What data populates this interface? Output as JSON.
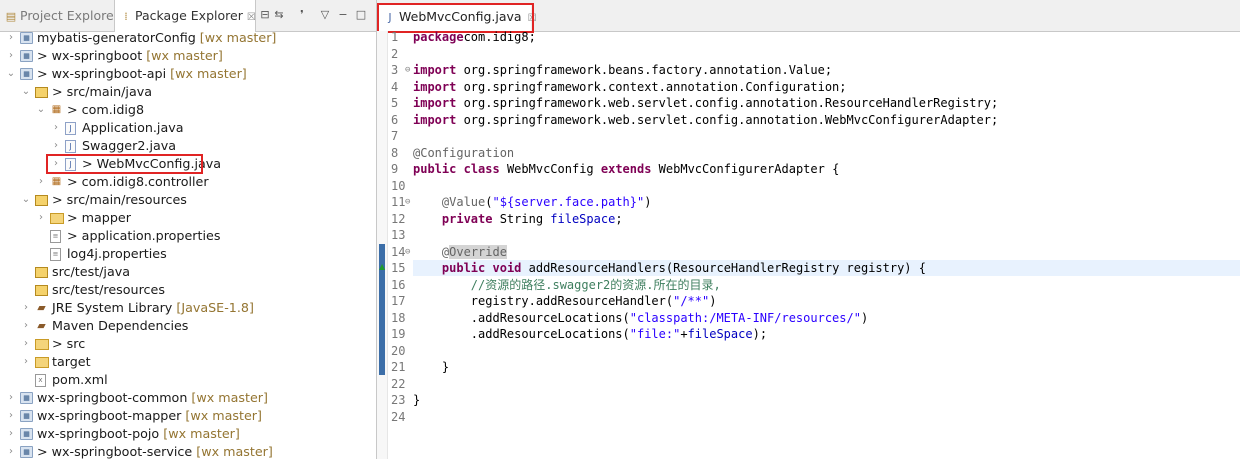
{
  "left_pane": {
    "tabs": [
      {
        "label": "Project Explorer"
      },
      {
        "label": "Package Explorer",
        "close": "☒"
      }
    ],
    "tree": [
      {
        "label": "mybatis-generatorConfig",
        "decoration": "[wx master]",
        "depth": 0,
        "expanded": false,
        "icon": "project-icon"
      },
      {
        "label": "> wx-springboot",
        "decoration": "[wx master]",
        "depth": 0,
        "expanded": false,
        "icon": "project-icon"
      },
      {
        "label": "> wx-springboot-api",
        "decoration": "[wx master]",
        "depth": 0,
        "expanded": true,
        "icon": "project-icon"
      },
      {
        "label": "> src/main/java",
        "decoration": "",
        "depth": 1,
        "expanded": true,
        "icon": "source-folder-icon"
      },
      {
        "label": "> com.idig8",
        "decoration": "",
        "depth": 2,
        "expanded": true,
        "icon": "package-icon"
      },
      {
        "label": "Application.java",
        "decoration": "",
        "depth": 3,
        "expanded": false,
        "icon": "java-file-icon"
      },
      {
        "label": "Swagger2.java",
        "decoration": "",
        "depth": 3,
        "expanded": false,
        "icon": "java-file-icon"
      },
      {
        "label": "> WebMvcConfig.java",
        "decoration": "",
        "depth": 3,
        "expanded": false,
        "icon": "java-file-icon",
        "selected": true
      },
      {
        "label": "> com.idig8.controller",
        "decoration": "",
        "depth": 2,
        "expanded": false,
        "icon": "package-icon"
      },
      {
        "label": "> src/main/resources",
        "decoration": "",
        "depth": 1,
        "expanded": true,
        "icon": "source-folder-icon"
      },
      {
        "label": "> mapper",
        "decoration": "",
        "depth": 2,
        "expanded": false,
        "icon": "folder-icon"
      },
      {
        "label": "> application.properties",
        "decoration": "",
        "depth": 2,
        "leaf": true,
        "icon": "properties-file-icon"
      },
      {
        "label": "log4j.properties",
        "decoration": "",
        "depth": 2,
        "leaf": true,
        "icon": "properties-file-icon"
      },
      {
        "label": "src/test/java",
        "decoration": "",
        "depth": 1,
        "leaf": true,
        "icon": "source-folder-icon"
      },
      {
        "label": "src/test/resources",
        "decoration": "",
        "depth": 1,
        "leaf": true,
        "icon": "source-folder-icon"
      },
      {
        "label": "JRE System Library",
        "decoration": "[JavaSE-1.8]",
        "depth": 1,
        "expanded": false,
        "icon": "library-icon"
      },
      {
        "label": "Maven Dependencies",
        "decoration": "",
        "depth": 1,
        "expanded": false,
        "icon": "library-icon"
      },
      {
        "label": "> src",
        "decoration": "",
        "depth": 1,
        "expanded": false,
        "icon": "folder-icon"
      },
      {
        "label": "target",
        "decoration": "",
        "depth": 1,
        "expanded": false,
        "icon": "folder-icon"
      },
      {
        "label": "pom.xml",
        "decoration": "",
        "depth": 1,
        "leaf": true,
        "icon": "xml-file-icon"
      },
      {
        "label": "wx-springboot-common",
        "decoration": "[wx master]",
        "depth": 0,
        "expanded": false,
        "icon": "project-icon"
      },
      {
        "label": "wx-springboot-mapper",
        "decoration": "[wx master]",
        "depth": 0,
        "expanded": false,
        "icon": "project-icon"
      },
      {
        "label": "wx-springboot-pojo",
        "decoration": "[wx master]",
        "depth": 0,
        "expanded": false,
        "icon": "project-icon"
      },
      {
        "label": "> wx-springboot-service",
        "decoration": "[wx master]",
        "depth": 0,
        "expanded": false,
        "icon": "project-icon"
      }
    ]
  },
  "editor": {
    "tab": {
      "label": "WebMvcConfig.java",
      "close": "☒"
    },
    "lines": [
      {
        "n": "1",
        "fold": "",
        "tokens": [
          [
            "kw",
            "package"
          ],
          [
            "",
            "com.idig8;"
          ]
        ]
      },
      {
        "n": "2",
        "fold": "",
        "tokens": []
      },
      {
        "n": "3",
        "fold": "⊖",
        "tokens": [
          [
            "kw",
            "import"
          ],
          [
            "",
            " org.springframework.beans.factory.annotation.Value;"
          ]
        ]
      },
      {
        "n": "4",
        "fold": "",
        "tokens": [
          [
            "kw",
            "import"
          ],
          [
            "",
            " org.springframework.context.annotation.Configuration;"
          ]
        ]
      },
      {
        "n": "5",
        "fold": "",
        "tokens": [
          [
            "kw",
            "import"
          ],
          [
            "",
            " org.springframework.web.servlet.config.annotation.ResourceHandlerRegistry;"
          ]
        ]
      },
      {
        "n": "6",
        "fold": "",
        "tokens": [
          [
            "kw",
            "import"
          ],
          [
            "",
            " org.springframework.web.servlet.config.annotation.WebMvcConfigurerAdapter;"
          ]
        ]
      },
      {
        "n": "7",
        "fold": "",
        "tokens": []
      },
      {
        "n": "8",
        "fold": "",
        "tokens": [
          [
            "ann",
            "@Configuration"
          ]
        ]
      },
      {
        "n": "9",
        "fold": "",
        "tokens": [
          [
            "kw",
            "public"
          ],
          [
            "",
            " "
          ],
          [
            "kw",
            "class"
          ],
          [
            "",
            " WebMvcConfig "
          ],
          [
            "kw",
            "extends"
          ],
          [
            "",
            " WebMvcConfigurerAdapter {"
          ]
        ]
      },
      {
        "n": "10",
        "fold": "",
        "tokens": []
      },
      {
        "n": "11",
        "fold": "⊖",
        "tokens": [
          [
            "",
            "    "
          ],
          [
            "ann",
            "@Value"
          ],
          [
            "",
            "("
          ],
          [
            "str",
            "\"${server.face.path}\""
          ],
          [
            "",
            ")"
          ]
        ]
      },
      {
        "n": "12",
        "fold": "",
        "tokens": [
          [
            "",
            "    "
          ],
          [
            "kw",
            "private"
          ],
          [
            "",
            " String "
          ],
          [
            "fld",
            "fileSpace"
          ],
          [
            "",
            ";"
          ]
        ]
      },
      {
        "n": "13",
        "fold": "",
        "tokens": []
      },
      {
        "n": "14",
        "fold": "⊖",
        "tokens": [
          [
            "",
            "    "
          ],
          [
            "ann",
            "@"
          ],
          [
            "ann ovr",
            "Override"
          ]
        ]
      },
      {
        "n": "15",
        "fold": "",
        "tokens": [
          [
            "",
            "    "
          ],
          [
            "kw",
            "public"
          ],
          [
            "",
            " "
          ],
          [
            "kw",
            "void"
          ],
          [
            "",
            " addResourceHandlers(ResourceHandlerRegistry registry) {"
          ]
        ]
      },
      {
        "n": "16",
        "fold": "",
        "tokens": [
          [
            "",
            "        "
          ],
          [
            "cmt",
            "//资源的路径.swagger2的资源.所在的目录,"
          ]
        ]
      },
      {
        "n": "17",
        "fold": "",
        "tokens": [
          [
            "",
            "        registry.addResourceHandler("
          ],
          [
            "str",
            "\"/**\""
          ],
          [
            "",
            ")"
          ]
        ]
      },
      {
        "n": "18",
        "fold": "",
        "tokens": [
          [
            "",
            "        .addResourceLocations("
          ],
          [
            "str",
            "\"classpath:/META-INF/resources/\""
          ],
          [
            "",
            ")"
          ]
        ]
      },
      {
        "n": "19",
        "fold": "",
        "tokens": [
          [
            "",
            "        .addResourceLocations("
          ],
          [
            "str",
            "\"file:\""
          ],
          [
            "",
            "+"
          ],
          [
            "fld",
            "fileSpace"
          ],
          [
            "",
            ");"
          ]
        ]
      },
      {
        "n": "20",
        "fold": "",
        "tokens": []
      },
      {
        "n": "21",
        "fold": "",
        "tokens": [
          [
            "",
            "    }"
          ]
        ]
      },
      {
        "n": "22",
        "fold": "",
        "tokens": []
      },
      {
        "n": "23",
        "fold": "",
        "tokens": [
          [
            "",
            "}"
          ]
        ]
      },
      {
        "n": "24",
        "fold": "",
        "tokens": []
      }
    ]
  },
  "colors": {
    "highlight_box": "#e02424",
    "keyword": "#7f0055",
    "string": "#2a00ff",
    "comment": "#3f7f5f",
    "field": "#0000c0",
    "annotation": "#646464"
  }
}
